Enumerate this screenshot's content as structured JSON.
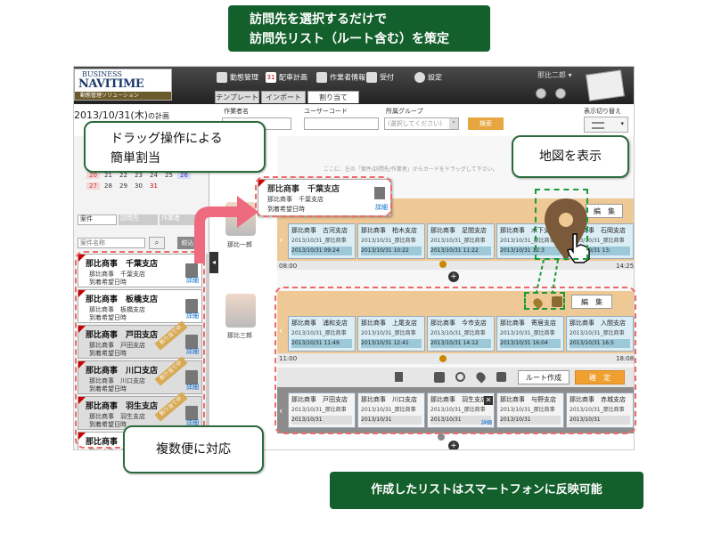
{
  "callouts": {
    "top_line1": "訪問先を選択するだけで",
    "top_line2": "訪問先リスト（ルート含む）を策定",
    "drag_line1": "ドラッグ操作による",
    "drag_line2": "簡単割当",
    "map": "地図を表示",
    "multi": "複数便に対応",
    "bottom": "作成したリストはスマートフォンに反映可能"
  },
  "app": {
    "logo_top": "BUSINESS",
    "logo_main": "NAVITIME",
    "logo_sub": "動態管理ソリューション",
    "nav": [
      "動態管理",
      "配車計画",
      "作業者情報",
      "受付",
      "設定"
    ],
    "nav_day": "31",
    "user": "那比二郎 ▾",
    "tabs": [
      "テンプレート",
      "インポート",
      "割り当て"
    ],
    "date": "2013/10/31(木)",
    "date_suffix": "の計画",
    "filters": {
      "worker_label": "作業者名",
      "usercode_label": "ユーザーコード",
      "group_label": "所属グループ",
      "group_value": "(選択してください)",
      "search_button": "検索"
    },
    "view_switch": "表示切り替え",
    "hint": "ここに、左の「案件/訪問先/作業者」からカードをドラッグして下さい。",
    "calendar": {
      "row1": [
        "20",
        "21",
        "22",
        "23",
        "24",
        "25",
        "26"
      ],
      "row2": [
        "27",
        "28",
        "29",
        "30",
        "31"
      ]
    },
    "left_tabs": [
      "案件",
      "訪問先",
      "作業者"
    ],
    "search_placeholder": "案件名称",
    "search_btn": "絞込み",
    "left_cards": [
      {
        "title": "那比商事　千葉支店",
        "sub": "那比商事　千葉支店",
        "arrive": "到着希望日時",
        "detail": "詳細",
        "ribbon": ""
      },
      {
        "title": "那比商事　板橋支店",
        "sub": "那比商事　板橋支店",
        "arrive": "到着希望日時",
        "detail": "詳細",
        "ribbon": ""
      },
      {
        "title": "那比商事　戸田支店",
        "sub": "那比商事　戸田支店",
        "arrive": "到着希望日時",
        "detail": "詳細",
        "ribbon": "割り当て中"
      },
      {
        "title": "那比商事　川口支店",
        "sub": "那比商事　川口支店",
        "arrive": "到着希望日時",
        "detail": "詳細",
        "ribbon": "割り当て中"
      },
      {
        "title": "那比商事　羽生支店",
        "sub": "那比商事　羽生支店",
        "arrive": "到着希望日時",
        "detail": "詳細",
        "ribbon": "割り当て中"
      },
      {
        "title": "那比商事　長岡支店",
        "sub": "那比商事　長岡支店",
        "arrive": "",
        "detail": "",
        "ribbon": ""
      }
    ],
    "drag_card": {
      "title": "那比商事　千葉支店",
      "sub": "那比商事　千葉支店",
      "arrive": "到着希望日時",
      "detail": "詳細"
    },
    "workers": [
      {
        "name": "那比一郎",
        "edit": "編　集",
        "start": "08:00",
        "end": "14:25",
        "cards": [
          {
            "name": "那比商事　古河支店",
            "sub": "2013/10/31_那比商事",
            "time": "2013/10/31 09:24"
          },
          {
            "name": "那比商事　柏木支店",
            "sub": "2013/10/31_那比商事",
            "time": "2013/10/31 10:22"
          },
          {
            "name": "那比商事　足間支店",
            "sub": "2013/10/31_那比商事",
            "time": "2013/10/31 11:22"
          },
          {
            "name": "那比商事　木下支店",
            "sub": "2013/10/31_那比商事",
            "time": "2013/10/31 12:3"
          },
          {
            "name": "那比商事　石岡支店",
            "sub": "2013/10/31_那比商事",
            "time": "2013/10/31 13:"
          }
        ]
      },
      {
        "name": "那比三郎",
        "edit": "編　集",
        "start": "11:00",
        "end": "18:08",
        "cards": [
          {
            "name": "那比商事　浦和支店",
            "sub": "2013/10/31_那比商事",
            "time": "2013/10/31 11:49"
          },
          {
            "name": "那比商事　上尾支店",
            "sub": "2013/10/31_那比商事",
            "time": "2013/10/31 12:41"
          },
          {
            "name": "那比商事　今市支店",
            "sub": "2013/10/31_那比商事",
            "time": "2013/10/31 14:12"
          },
          {
            "name": "那比商事　寄居支店",
            "sub": "2013/10/31_那比商事",
            "time": "2013/10/31 16:04"
          },
          {
            "name": "那比商事　入間支店",
            "sub": "2013/10/31_那比商事",
            "time": "2013/10/31 16:5"
          }
        ],
        "second": {
          "route_btn": "ルート作成",
          "confirm_btn": "確　定",
          "cards": [
            {
              "name": "那比商事　戸田支店",
              "sub": "2013/10/31_那比商事",
              "time": "2013/10/31"
            },
            {
              "name": "那比商事　川口支店",
              "sub": "2013/10/31_那比商事",
              "time": "2013/10/31"
            },
            {
              "name": "那比商事　羽生支店",
              "sub": "2013/10/31_那比商事",
              "time": "2013/10/31",
              "detail": "詳細"
            },
            {
              "name": "那比商事　与野支店",
              "sub": "2013/10/31_那比商事",
              "time": "2013/10/31"
            },
            {
              "name": "那比商事　赤城支店",
              "sub": "2013/10/31_那比商事",
              "time": "2013/10/31"
            }
          ]
        }
      }
    ]
  }
}
